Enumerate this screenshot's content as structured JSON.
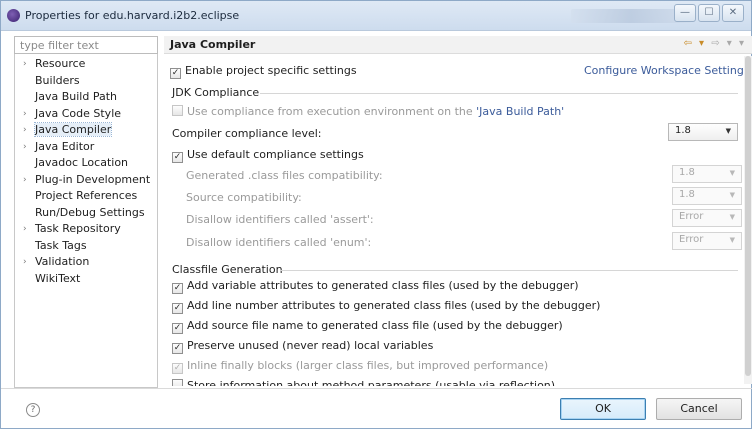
{
  "window": {
    "title": "Properties for edu.harvard.i2b2.eclipse",
    "controls": {
      "minimize": "—",
      "maximize": "☐",
      "close": "✕"
    }
  },
  "filter": {
    "placeholder": "type filter text"
  },
  "tree": {
    "items": [
      {
        "label": "Resource",
        "expandable": true
      },
      {
        "label": "Builders",
        "expandable": false
      },
      {
        "label": "Java Build Path",
        "expandable": false
      },
      {
        "label": "Java Code Style",
        "expandable": true
      },
      {
        "label": "Java Compiler",
        "expandable": true,
        "selected": true
      },
      {
        "label": "Java Editor",
        "expandable": true
      },
      {
        "label": "Javadoc Location",
        "expandable": false
      },
      {
        "label": "Plug-in Development",
        "expandable": true
      },
      {
        "label": "Project References",
        "expandable": false
      },
      {
        "label": "Run/Debug Settings",
        "expandable": false
      },
      {
        "label": "Task Repository",
        "expandable": true
      },
      {
        "label": "Task Tags",
        "expandable": false
      },
      {
        "label": "Validation",
        "expandable": true
      },
      {
        "label": "WikiText",
        "expandable": false
      }
    ]
  },
  "page": {
    "title": "Java Compiler",
    "enable_specific": {
      "label": "Enable project specific settings",
      "checked": true
    },
    "configure_link": "Configure Workspace Settings...",
    "jdk_group": "JDK Compliance",
    "use_compliance": {
      "prefix": "Use compliance from execution environment on the ",
      "link": "'Java Build Path'",
      "checked": false
    },
    "compliance_level": {
      "label": "Compiler compliance level:",
      "value": "1.8"
    },
    "use_default": {
      "label": "Use default compliance settings",
      "checked": true
    },
    "generated": {
      "label": "Generated .class files compatibility:",
      "value": "1.8"
    },
    "source": {
      "label": "Source compatibility:",
      "value": "1.8"
    },
    "assert": {
      "label": "Disallow identifiers called 'assert':",
      "value": "Error"
    },
    "enum": {
      "label": "Disallow identifiers called 'enum':",
      "value": "Error"
    },
    "classfile_group": "Classfile Generation",
    "classfile": [
      {
        "label": "Add variable attributes to generated class files (used by the debugger)",
        "checked": true,
        "enabled": true
      },
      {
        "label": "Add line number attributes to generated class files (used by the debugger)",
        "checked": true,
        "enabled": true
      },
      {
        "label": "Add source file name to generated class file (used by the debugger)",
        "checked": true,
        "enabled": true
      },
      {
        "label": "Preserve unused (never read) local variables",
        "checked": true,
        "enabled": true
      },
      {
        "label": "Inline finally blocks (larger class files, but improved performance)",
        "checked": true,
        "enabled": false
      },
      {
        "label": "Store information about method parameters (usable via reflection)",
        "checked": false,
        "enabled": true
      }
    ]
  },
  "footer": {
    "help": "?",
    "ok": "OK",
    "cancel": "Cancel"
  }
}
